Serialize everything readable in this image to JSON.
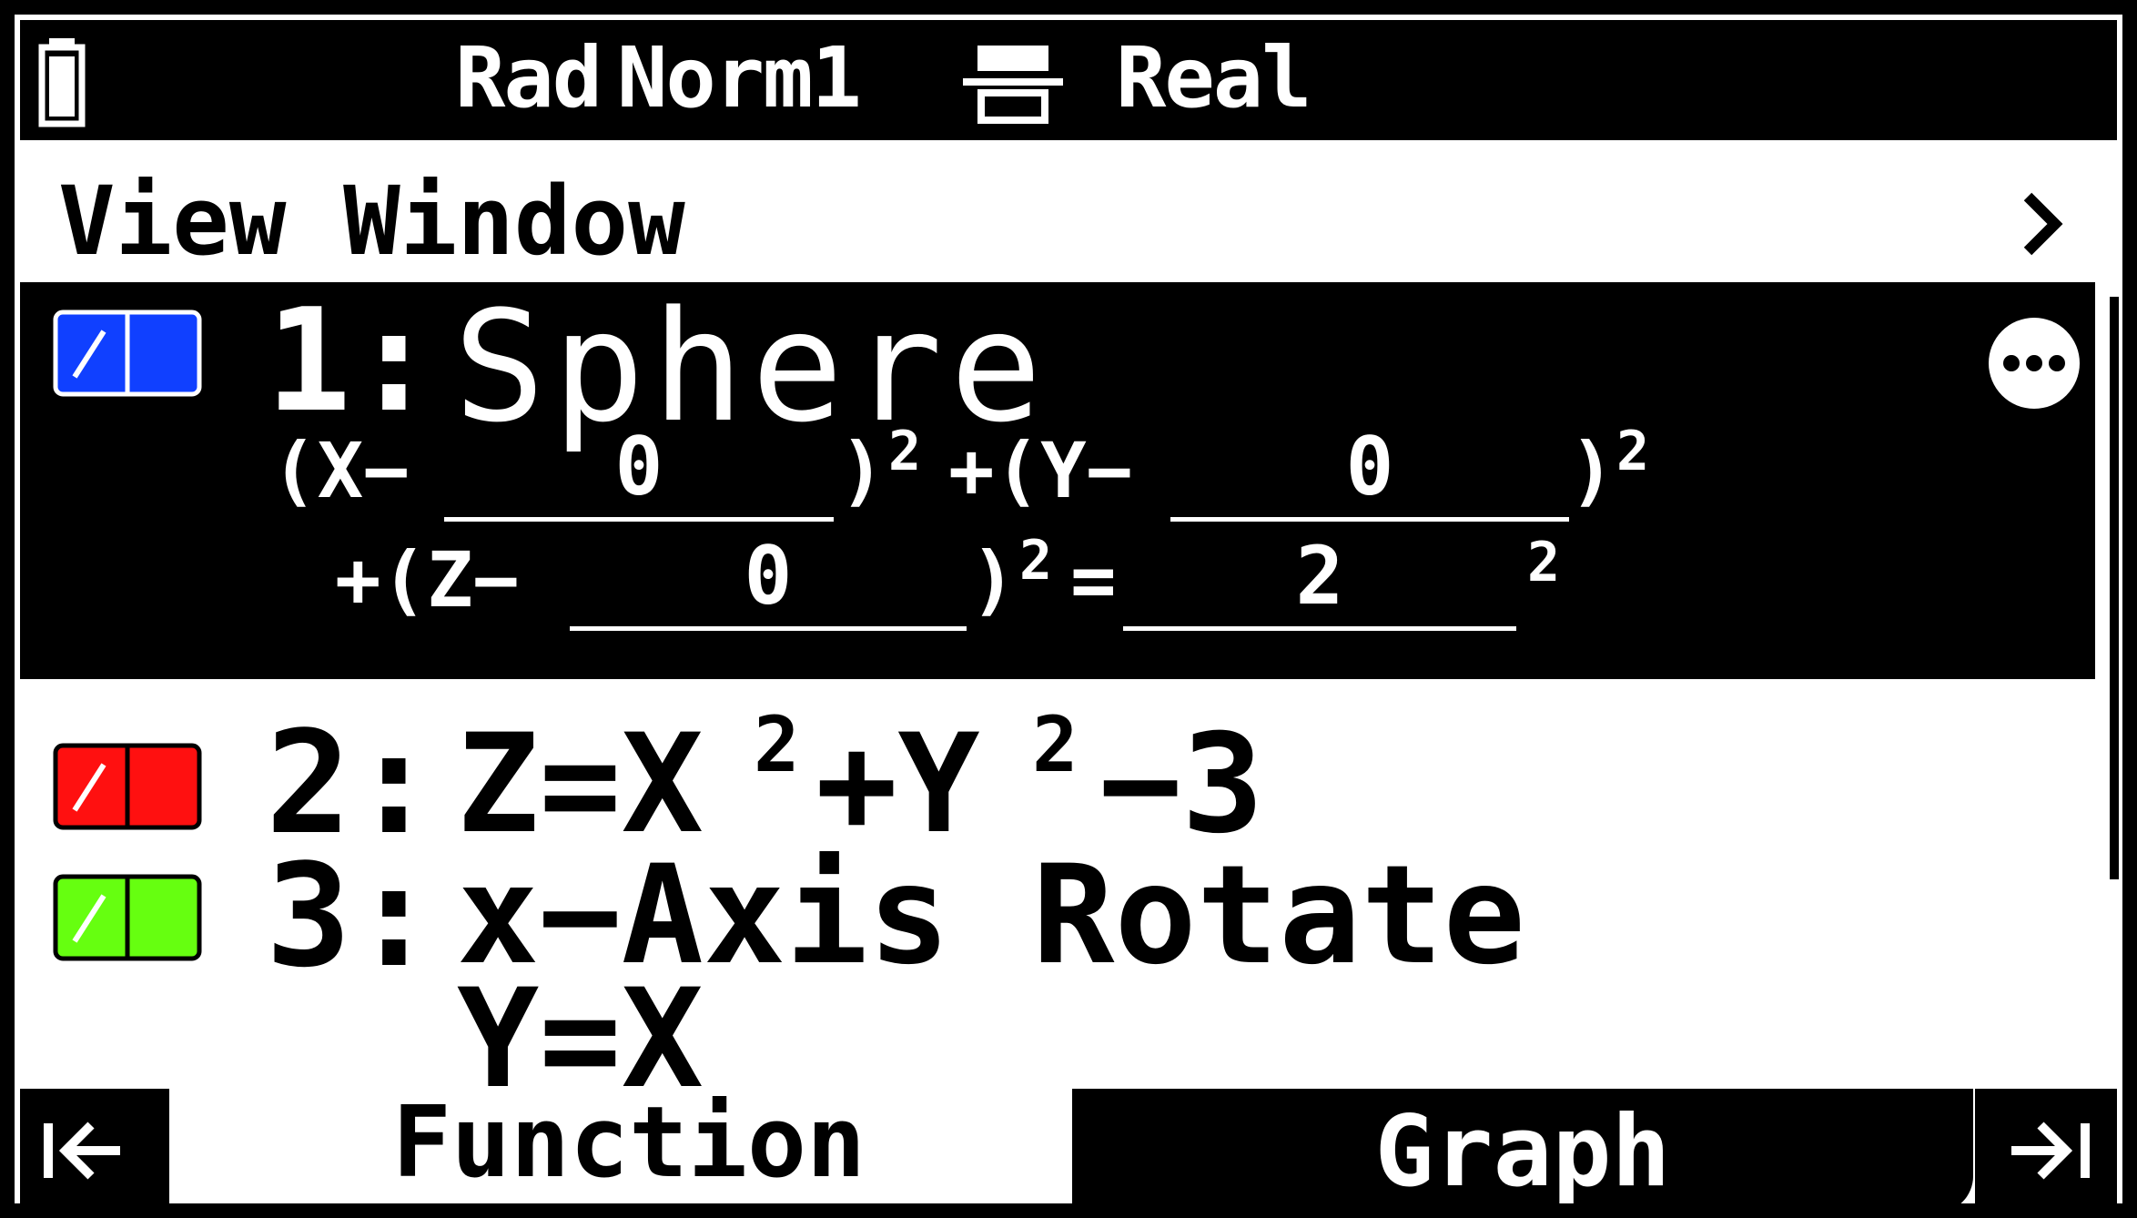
{
  "status_bar": {
    "angle_mode": "Rad",
    "display_mode": "Norm1",
    "complex_mode": "Real",
    "battery_icon": "battery-icon",
    "fraction_icon": "fraction-format-icon"
  },
  "view_window": {
    "label": "View Window",
    "chevron_icon": "chevron-right-icon"
  },
  "functions": [
    {
      "number": "1:",
      "title": "Sphere",
      "color": "#1040ff",
      "selected": true,
      "equation": {
        "part1": "(X−",
        "x0": "0",
        "part2": ")",
        "sup1": "2",
        "part3": "+(Y−",
        "y0": "0",
        "part4": ")",
        "sup2": "2",
        "part5": "+(Z−",
        "z0": "0",
        "part6": ")",
        "sup3": "2",
        "part7": "=",
        "r": "2",
        "sup4": "2"
      }
    },
    {
      "number": "2:",
      "expr_a": "Z=X",
      "sup_a": "2",
      "expr_b": "+Y",
      "sup_b": "2",
      "expr_c": "−3",
      "color": "#ff1010"
    },
    {
      "number": "3:",
      "expr": "x−Axis Rotate",
      "expr2": "Y=X",
      "color": "#66ff10"
    }
  ],
  "more_icon": "more-options-icon",
  "bottom_tabs": {
    "left_nav_icon": "jump-to-start-icon",
    "function_label": "Function",
    "graph_label": "Graph",
    "right_nav_icon": "jump-to-end-icon"
  }
}
